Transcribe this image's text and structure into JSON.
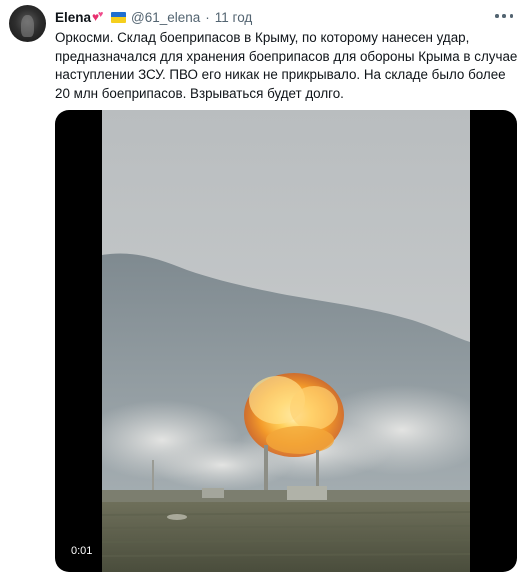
{
  "tweet": {
    "author": {
      "display_name": "Elena",
      "name_emoji": "heart-emoji",
      "flag_emoji": "ukraine-flag",
      "handle": "@61_elena",
      "separator": "·",
      "time": "11 год"
    },
    "text": "Оркосми. Склад боеприпасов в Крыму, по которому нанесен удар, предназначался для хранения боеприпасов для обороны Крыма в случае наступлении ЗСУ. ПВО его никак не прикрывало. На складе было более 20 млн боеприпасов. Взрываться будет долго.",
    "media": {
      "type": "video",
      "elapsed_time": "0:01"
    },
    "more_icon": "more-dots-icon"
  },
  "colors": {
    "text": "#0f1419",
    "secondary": "#536471",
    "flag_blue": "#1f6fd1",
    "flag_yellow": "#f5cf1d",
    "heart": "#e8306f"
  }
}
